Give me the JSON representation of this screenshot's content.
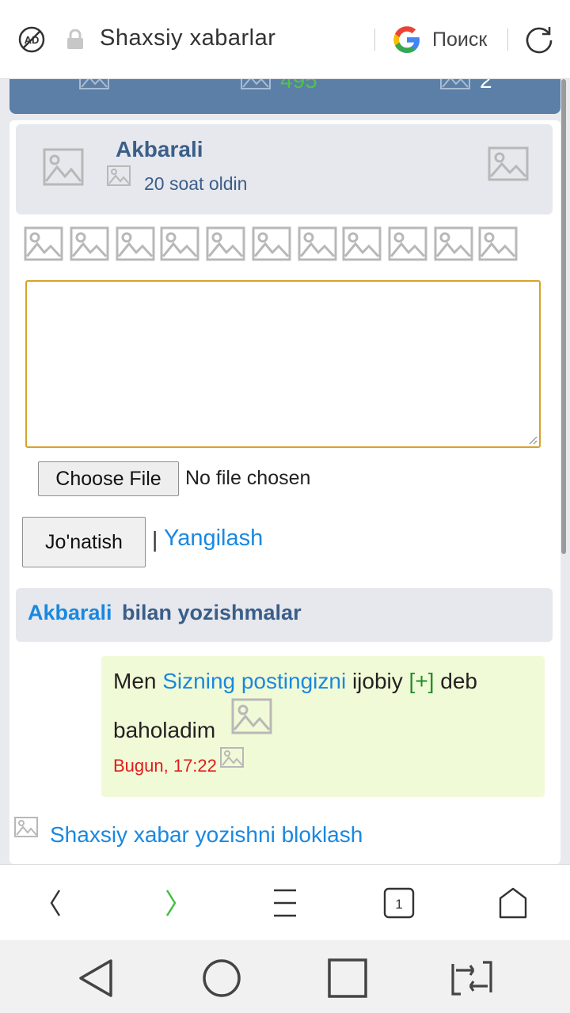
{
  "browser": {
    "page_title": "Shaxsiy xabarlar",
    "search_label": "Поиск",
    "tab_count": "1"
  },
  "stats": {
    "count_green": "495",
    "count_white": "2"
  },
  "user_card": {
    "username": "Akbarali",
    "time": "20 soat oldin"
  },
  "form": {
    "file_button": "Choose File",
    "file_status": "No file chosen",
    "send_button": "Jo'natish",
    "separator": "|",
    "refresh_link": "Yangilash"
  },
  "conversation": {
    "user": "Akbarali",
    "title_suffix": "bilan yozishmalar",
    "message": {
      "text_start": "Men ",
      "link_text": "Sizning postingizni",
      "text_mid": " ijobiy ",
      "plus": "[+]",
      "text_end": " deb",
      "text_line2": "baholadim",
      "time": "Bugun, 17:22"
    }
  },
  "block_link": "Shaxsiy xabar yozishni bloklash",
  "colors": {
    "accent_link": "#1a88e0",
    "header_blue": "#5b7fa7",
    "textarea_focus": "#d9a129",
    "message_bg": "#f1fad6",
    "time_red": "#e01c1c"
  }
}
